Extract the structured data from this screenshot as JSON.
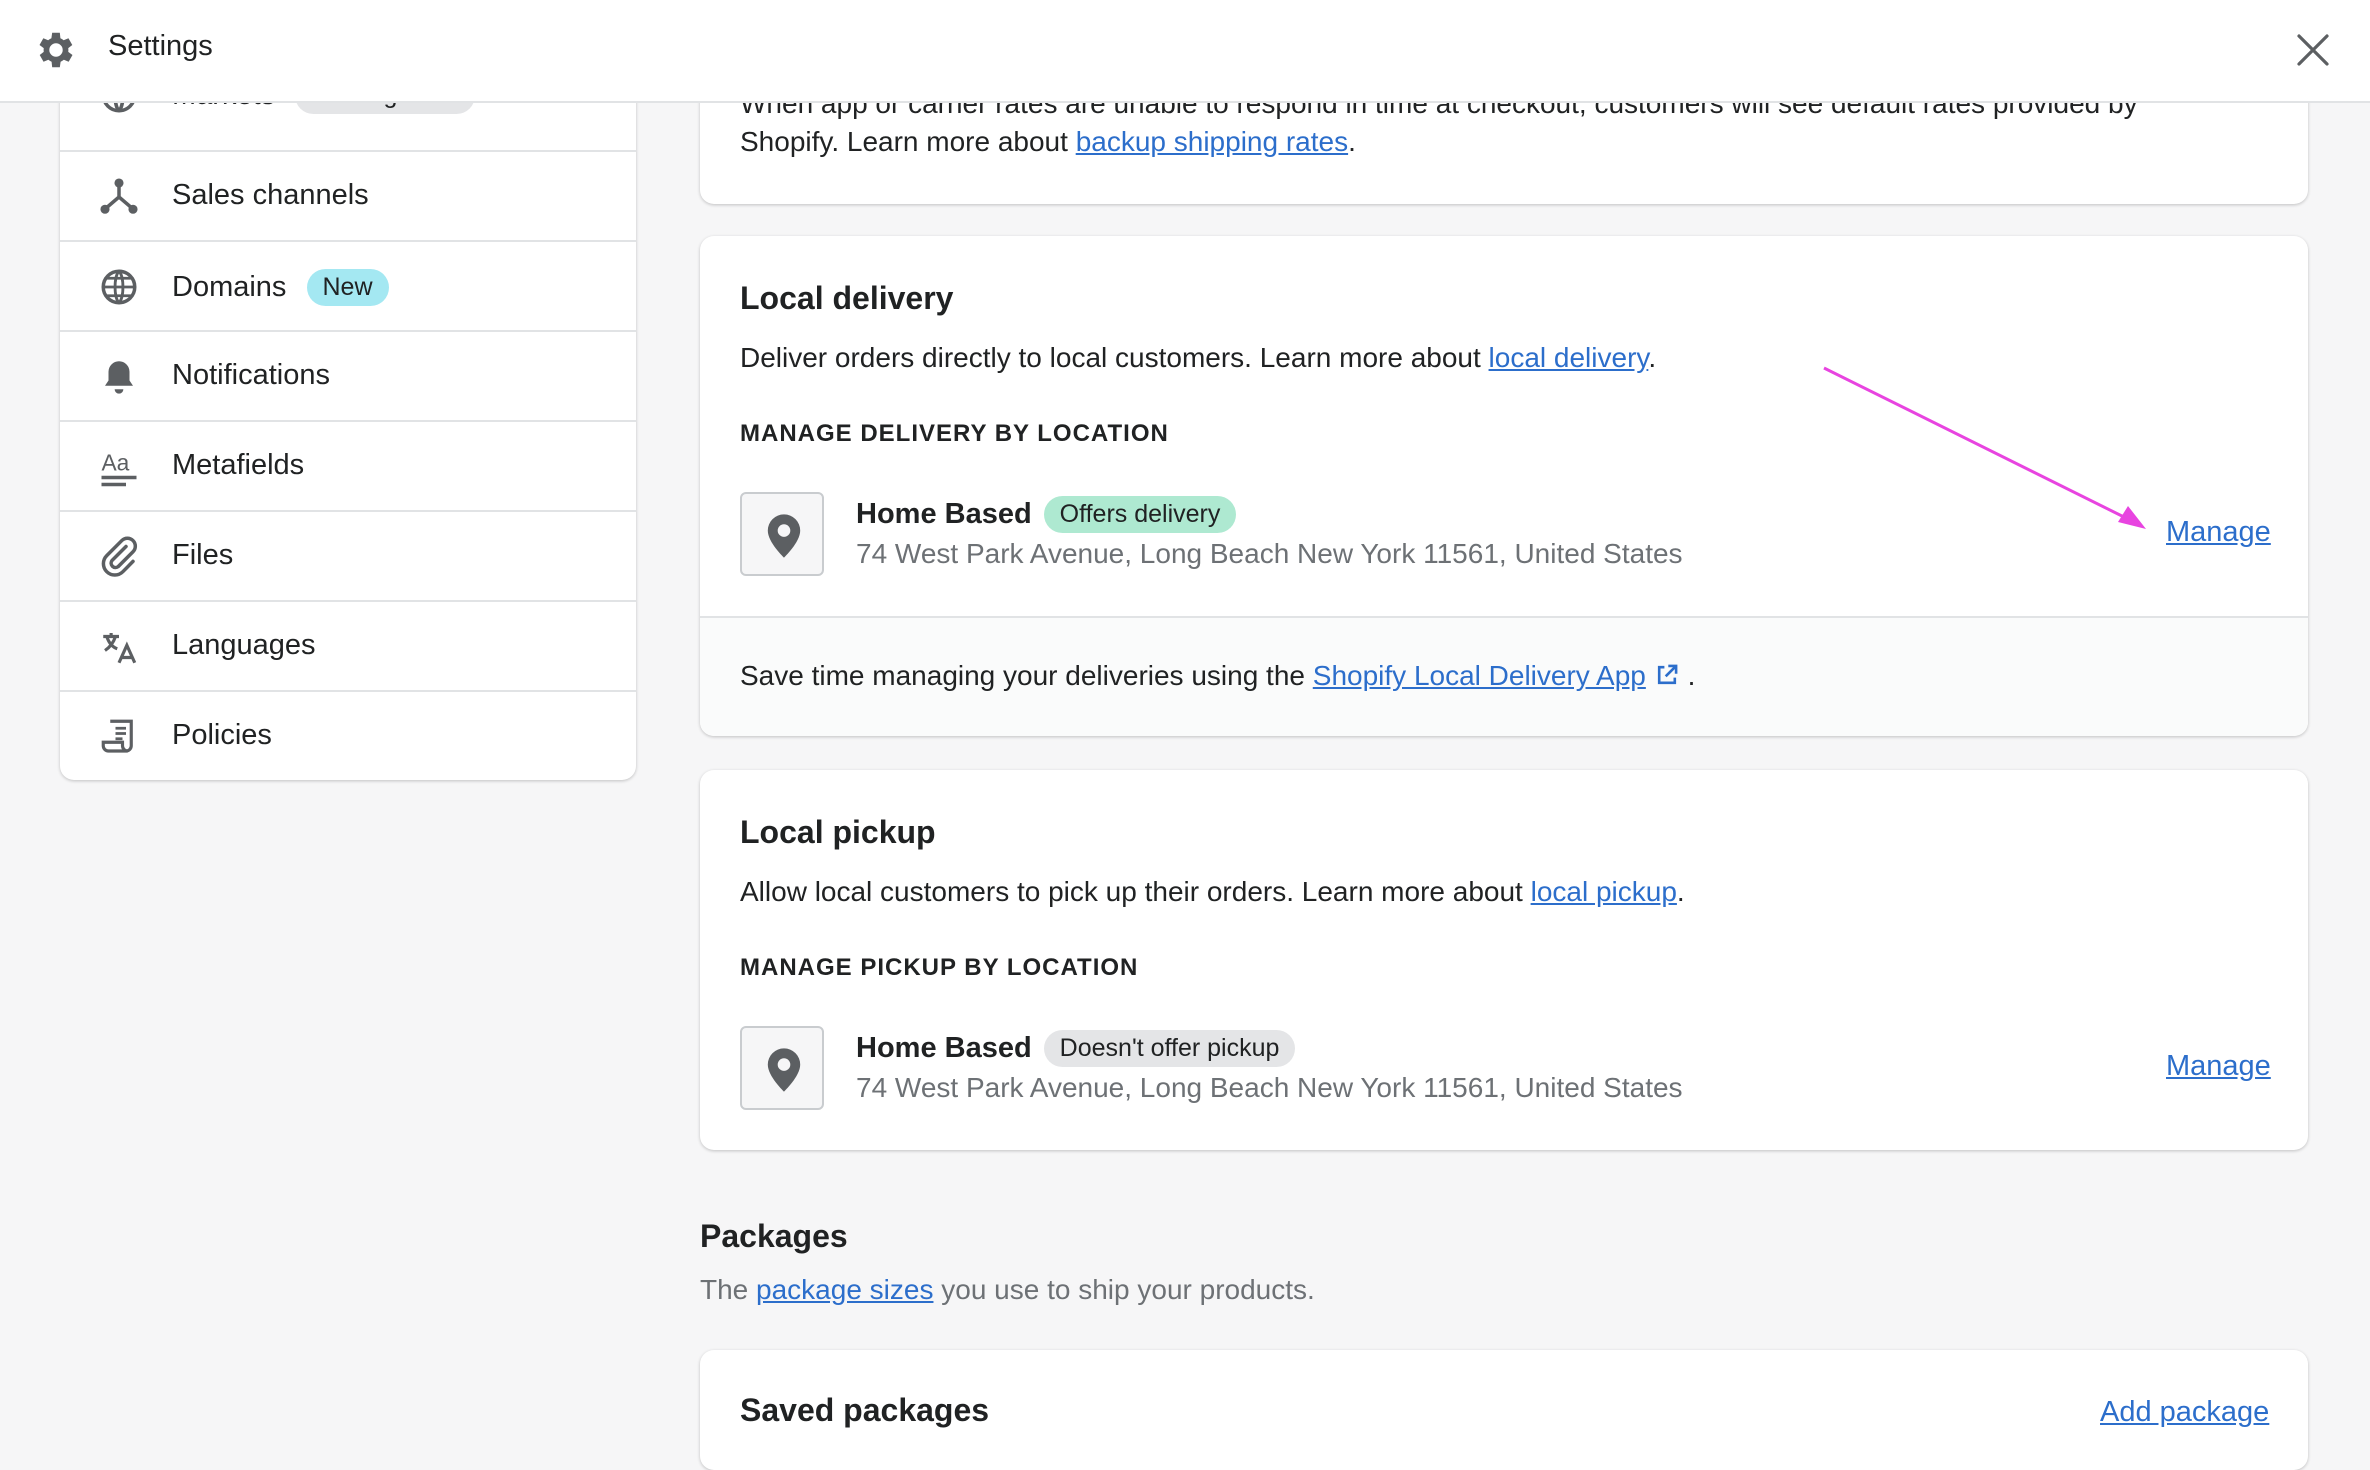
{
  "header": {
    "title": "Settings",
    "icon": "gear-icon"
  },
  "sidebar": {
    "items": [
      {
        "label": "Markets",
        "badge": "Coming soon",
        "icon": "globe-icon"
      },
      {
        "label": "Sales channels",
        "icon": "sales-channels-icon"
      },
      {
        "label": "Domains",
        "badge": "New",
        "icon": "globe-icon"
      },
      {
        "label": "Notifications",
        "icon": "bell-icon"
      },
      {
        "label": "Metafields",
        "icon": "metafields-icon"
      },
      {
        "label": "Files",
        "icon": "paperclip-icon"
      },
      {
        "label": "Languages",
        "icon": "translate-icon"
      },
      {
        "label": "Policies",
        "icon": "policy-icon"
      }
    ]
  },
  "backup_card": {
    "line1": "When app or carrier rates are unable to respond in time at checkout, customers will see default rates provided by",
    "line2_prefix": "Shopify. Learn more about ",
    "line2_link": "backup shipping rates",
    "line2_suffix": "."
  },
  "local_delivery": {
    "title": "Local delivery",
    "desc_prefix": "Deliver orders directly to local customers. Learn more about ",
    "desc_link": "local delivery",
    "desc_suffix": ".",
    "subheading": "MANAGE DELIVERY BY LOCATION",
    "location": {
      "name": "Home Based",
      "badge": "Offers delivery",
      "address": "74 West Park Avenue, Long Beach New York 11561, United States",
      "action": "Manage"
    },
    "footer_prefix": "Save time managing your deliveries using the ",
    "footer_link": "Shopify Local Delivery App",
    "footer_suffix": " ."
  },
  "local_pickup": {
    "title": "Local pickup",
    "desc_prefix": "Allow local customers to pick up their orders. Learn more about ",
    "desc_link": "local pickup",
    "desc_suffix": ".",
    "subheading": "MANAGE PICKUP BY LOCATION",
    "location": {
      "name": "Home Based",
      "badge": "Doesn't offer pickup",
      "address": "74 West Park Avenue, Long Beach New York 11561, United States",
      "action": "Manage"
    }
  },
  "packages": {
    "title": "Packages",
    "desc_prefix": "The ",
    "desc_link": "package sizes",
    "desc_suffix": " you use to ship your products."
  },
  "saved_packages": {
    "title": "Saved packages",
    "action": "Add package"
  },
  "colors": {
    "accent_link": "#2c6ecb",
    "annotation_arrow": "#e844e0",
    "badge_green": "#aee9d1",
    "badge_blue": "#a4e8f2",
    "badge_grey": "#e4e5e7"
  }
}
